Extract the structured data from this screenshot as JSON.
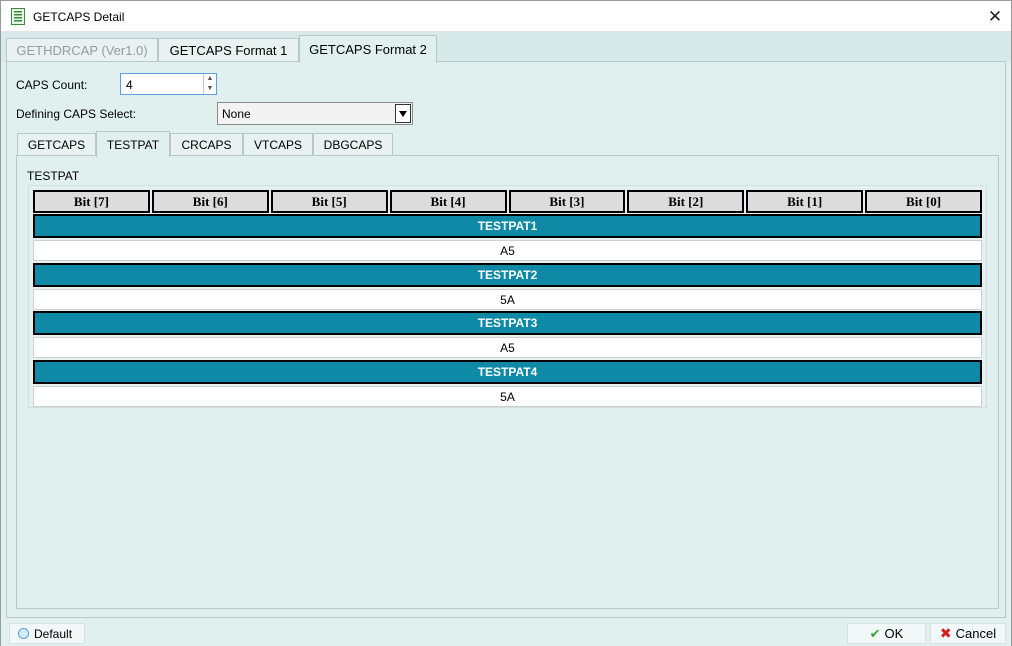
{
  "window": {
    "title": "GETCAPS Detail",
    "close_symbol": "✕"
  },
  "main_tabs": [
    {
      "label": "GETHDRCAP (Ver1.0)",
      "state": "disabled"
    },
    {
      "label": "GETCAPS Format 1",
      "state": "normal"
    },
    {
      "label": "GETCAPS Format 2",
      "state": "active"
    }
  ],
  "form": {
    "caps_count_label": "CAPS Count:",
    "caps_count_value": "4",
    "defining_caps_label": "Defining CAPS Select:",
    "defining_caps_value": "None"
  },
  "sub_tabs": [
    {
      "label": "GETCAPS",
      "active": false
    },
    {
      "label": "TESTPAT",
      "active": true
    },
    {
      "label": "CRCAPS",
      "active": false
    },
    {
      "label": "VTCAPS",
      "active": false
    },
    {
      "label": "DBGCAPS",
      "active": false
    }
  ],
  "panel": {
    "section_title": "TESTPAT",
    "bit_headers": [
      "Bit [7]",
      "Bit [6]",
      "Bit [5]",
      "Bit [4]",
      "Bit [3]",
      "Bit [2]",
      "Bit [1]",
      "Bit [0]"
    ],
    "rows": [
      {
        "name": "TESTPAT1",
        "value": "A5"
      },
      {
        "name": "TESTPAT2",
        "value": "5A"
      },
      {
        "name": "TESTPAT3",
        "value": "A5"
      },
      {
        "name": "TESTPAT4",
        "value": "5A"
      }
    ]
  },
  "footer": {
    "default_label": "Default",
    "ok_label": "OK",
    "cancel_label": "Cancel"
  },
  "colors": {
    "row_header": "#0e89a6",
    "background": "#dff0ef",
    "ok_icon": "#34a634",
    "cancel_icon": "#d21f1f"
  },
  "icons": {
    "app": "document-list-icon",
    "close": "close-icon",
    "ok": "check-icon",
    "cancel": "x-icon",
    "default": "radio-icon"
  }
}
